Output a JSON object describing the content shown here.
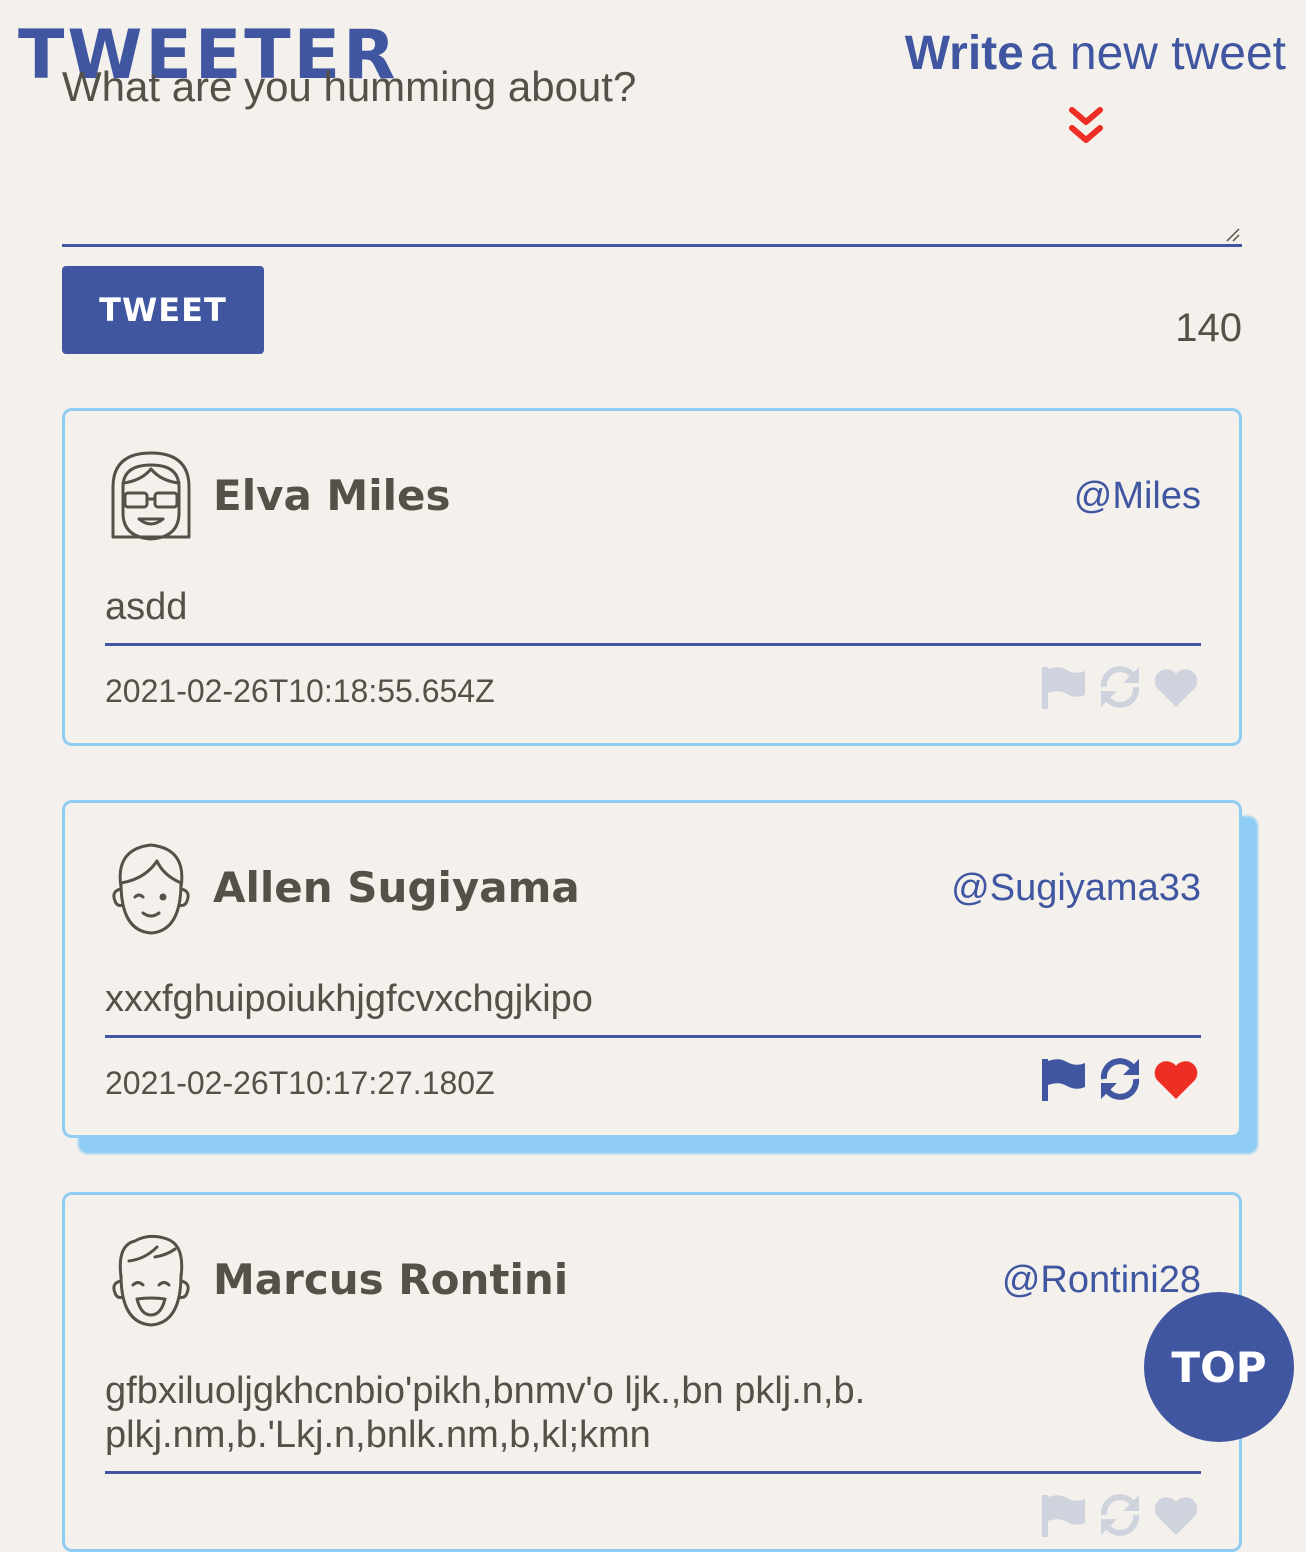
{
  "header": {
    "logo": "TWEETER",
    "write_strong": "Write",
    "write_rest": "a new tweet",
    "chevron_icon": "double-chevron-down-icon"
  },
  "compose": {
    "placeholder": "What are you humming about?",
    "button_label": "TWEET",
    "counter": "140"
  },
  "colors": {
    "brand": "#4056a1",
    "accent_border": "#8fcdf5",
    "like_red": "#ee2e24",
    "inactive_icon": "#cfd3de",
    "background": "#f4f1ec"
  },
  "tweets": [
    {
      "name": "Elva Miles",
      "handle": "@Miles",
      "text": "asdd",
      "timestamp": "2021-02-26T10:18:55.654Z",
      "avatar_icon": "girl-sunglasses-avatar-icon",
      "actions_active": false
    },
    {
      "name": "Allen Sugiyama",
      "handle": "@Sugiyama33",
      "text": "xxxfghuipoiukhjgfcvxchgjkipo",
      "timestamp": "2021-02-26T10:17:27.180Z",
      "avatar_icon": "boy-wink-avatar-icon",
      "actions_active": true
    },
    {
      "name": "Marcus Rontini",
      "handle": "@Rontini28",
      "text_line1": "gfbxiluoljgkhcnbio'pikh,bnmv'o ljk.,bn pklj.n,b.",
      "text_line2": "plkj.nm,b.'Lkj.n,bnlk.nm,b,kl;kmn",
      "avatar_icon": "boy-laughing-avatar-icon",
      "actions_active": false
    }
  ],
  "scroll_top_label": "TOP"
}
